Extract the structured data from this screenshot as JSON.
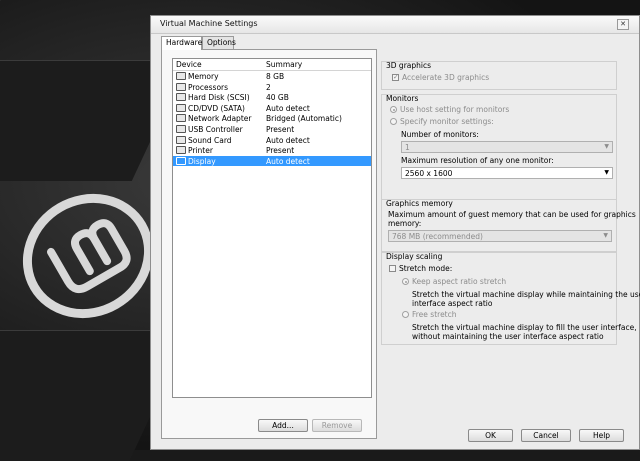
{
  "window": {
    "title": "Virtual Machine Settings",
    "close_glyph": "✕"
  },
  "tabs": [
    {
      "label": "Hardware"
    },
    {
      "label": "Options"
    }
  ],
  "device_list": {
    "col_device": "Device",
    "col_summary": "Summary",
    "rows": [
      {
        "device": "Memory",
        "summary": "8 GB",
        "icon": "memory-icon"
      },
      {
        "device": "Processors",
        "summary": "2",
        "icon": "processor-icon"
      },
      {
        "device": "Hard Disk (SCSI)",
        "summary": "40 GB",
        "icon": "hard-disk-icon"
      },
      {
        "device": "CD/DVD (SATA)",
        "summary": "Auto detect",
        "icon": "cd-dvd-icon"
      },
      {
        "device": "Network Adapter",
        "summary": "Bridged (Automatic)",
        "icon": "network-adapter-icon"
      },
      {
        "device": "USB Controller",
        "summary": "Present",
        "icon": "usb-icon"
      },
      {
        "device": "Sound Card",
        "summary": "Auto detect",
        "icon": "sound-card-icon"
      },
      {
        "device": "Printer",
        "summary": "Present",
        "icon": "printer-icon"
      },
      {
        "device": "Display",
        "summary": "Auto detect",
        "icon": "display-icon",
        "selected": true
      }
    ],
    "add_label": "Add...",
    "remove_label": "Remove"
  },
  "graphics3d": {
    "title": "3D graphics",
    "accelerate_label": "Accelerate 3D graphics",
    "accelerate_checked": true
  },
  "monitors": {
    "title": "Monitors",
    "use_host_label": "Use host setting for monitors",
    "specify_label": "Specify monitor settings:",
    "number_label": "Number of monitors:",
    "number_value": "1",
    "max_res_label": "Maximum resolution of any one monitor:",
    "max_res_value": "2560 x 1600"
  },
  "graphics_memory": {
    "title": "Graphics memory",
    "desc_line1": "Maximum amount of guest memory that can be used for graphics",
    "desc_line2": "memory:",
    "value": "768 MB (recommended)"
  },
  "display_scaling": {
    "title": "Display scaling",
    "stretch_mode_label": "Stretch mode:",
    "keep_aspect_label": "Keep aspect ratio stretch",
    "keep_aspect_desc1": "Stretch the virtual machine display while maintaining the user",
    "keep_aspect_desc2": "interface aspect ratio",
    "free_stretch_label": "Free stretch",
    "free_stretch_desc1": "Stretch the virtual machine display to fill the user interface,",
    "free_stretch_desc2": "without maintaining the user interface aspect ratio"
  },
  "footer": {
    "ok_label": "OK",
    "cancel_label": "Cancel",
    "help_label": "Help"
  }
}
